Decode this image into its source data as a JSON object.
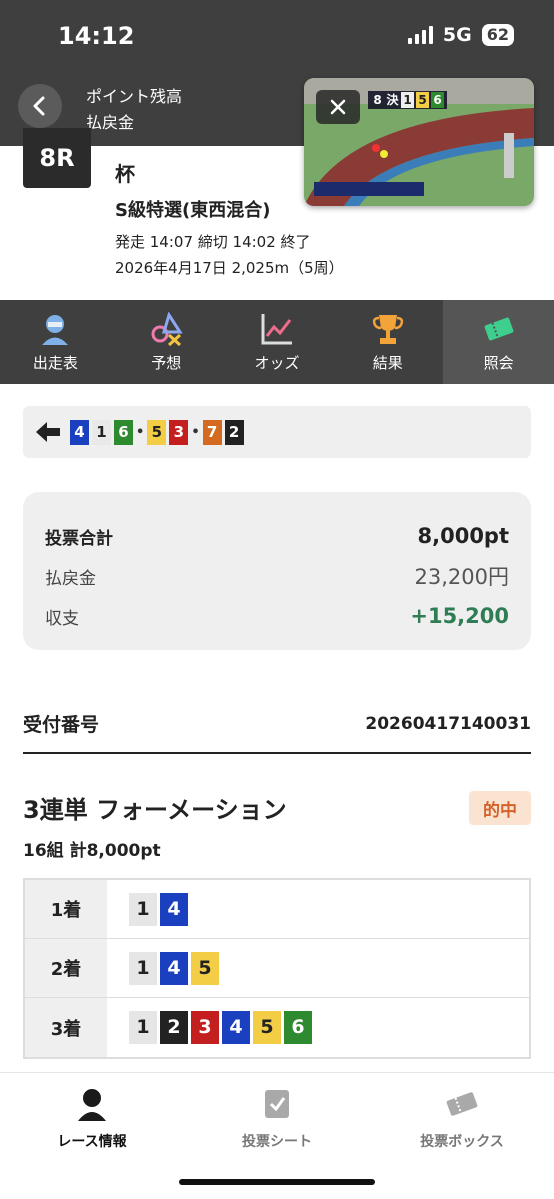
{
  "status": {
    "time": "14:12",
    "network": "5G",
    "battery": "62"
  },
  "header": {
    "line1": "ポイント残高",
    "line2": "払戻金"
  },
  "video": {
    "overlay_digits": [
      "8",
      "決",
      "1",
      "5",
      "6"
    ]
  },
  "race": {
    "number": "8R",
    "title": "杯",
    "class": "S級特選(東西混合)",
    "times": "発走 14:07 締切 14:02  終了",
    "date_distance": "2026年4月17日 2,025m（5周）"
  },
  "nav": {
    "tabs": [
      "出走表",
      "予想",
      "オッズ",
      "結果",
      "照会"
    ],
    "active": "照会"
  },
  "result_order": [
    {
      "num": "4",
      "color": "#1a3fbf"
    },
    {
      "num": "1",
      "color": "#e9e9e9"
    },
    {
      "num": "6",
      "color": "#2e8a2e"
    },
    {
      "num": "5",
      "color": "#f3cd45"
    },
    {
      "num": "3",
      "color": "#c41f1f"
    },
    {
      "num": "7",
      "color": "#d46a1f"
    },
    {
      "num": "2",
      "color": "#222222"
    }
  ],
  "result_separators": [
    "•",
    "•"
  ],
  "summary": {
    "total_label": "投票合計",
    "total_value": "8,000pt",
    "payout_label": "払戻金",
    "payout_value": "23,200円",
    "balance_label": "収支",
    "balance_value": "+15,200"
  },
  "receipt": {
    "label": "受付番号",
    "value": "20260417140031"
  },
  "bet": {
    "type": "3連単 フォーメーション",
    "status": "的中",
    "combo": "16組 計8,000pt"
  },
  "formation": [
    {
      "place": "1着",
      "numbers": [
        "1",
        "4"
      ]
    },
    {
      "place": "2着",
      "numbers": [
        "1",
        "4",
        "5"
      ]
    },
    {
      "place": "3着",
      "numbers": [
        "1",
        "2",
        "3",
        "4",
        "5",
        "6"
      ]
    }
  ],
  "number_colors": {
    "1": {
      "bg": "#e6e6e6",
      "fg": "#222222"
    },
    "2": {
      "bg": "#222222",
      "fg": "#ffffff"
    },
    "3": {
      "bg": "#c41f1f",
      "fg": "#ffffff"
    },
    "4": {
      "bg": "#1a3fbf",
      "fg": "#ffffff"
    },
    "5": {
      "bg": "#f3cd45",
      "fg": "#222222"
    },
    "6": {
      "bg": "#2e8a2e",
      "fg": "#ffffff"
    },
    "7": {
      "bg": "#d46a1f",
      "fg": "#ffffff"
    }
  },
  "tabbar": {
    "items": [
      "レース情報",
      "投票シート",
      "投票ボックス"
    ],
    "active": "レース情報"
  }
}
